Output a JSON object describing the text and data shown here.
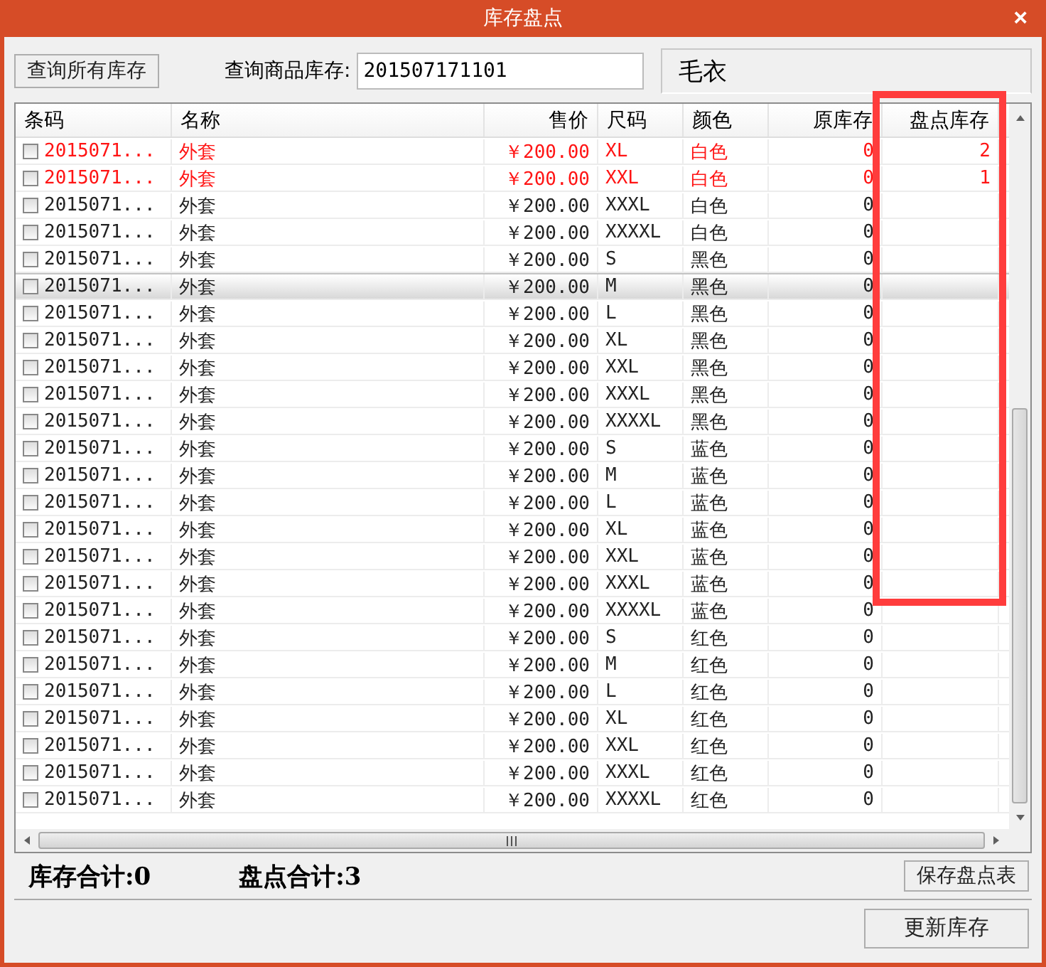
{
  "window": {
    "title": "库存盘点",
    "close": "×"
  },
  "toolbar": {
    "query_all_button": "查询所有库存",
    "search_label": "查询商品库存:",
    "search_value": "201507171101",
    "product_name": "毛衣"
  },
  "table": {
    "columns": [
      "条码",
      "名称",
      "售价",
      "尺码",
      "颜色",
      "原库存",
      "盘点库存"
    ],
    "rows": [
      {
        "checked": false,
        "modified": true,
        "selected": false,
        "barcode": "2015071...",
        "name": "外套",
        "price": "￥200.00",
        "size": "XL",
        "color_name": "白色",
        "stock": "0",
        "count": "2"
      },
      {
        "checked": false,
        "modified": true,
        "selected": false,
        "barcode": "2015071...",
        "name": "外套",
        "price": "￥200.00",
        "size": "XXL",
        "color_name": "白色",
        "stock": "0",
        "count": "1"
      },
      {
        "checked": false,
        "modified": false,
        "selected": false,
        "barcode": "2015071...",
        "name": "外套",
        "price": "￥200.00",
        "size": "XXXL",
        "color_name": "白色",
        "stock": "0"
      },
      {
        "checked": false,
        "modified": false,
        "selected": false,
        "barcode": "2015071...",
        "name": "外套",
        "price": "￥200.00",
        "size": "XXXXL",
        "color_name": "白色",
        "stock": "0"
      },
      {
        "checked": false,
        "modified": false,
        "selected": false,
        "barcode": "2015071...",
        "name": "外套",
        "price": "￥200.00",
        "size": "S",
        "color_name": "黑色",
        "stock": "0"
      },
      {
        "checked": false,
        "modified": false,
        "selected": true,
        "barcode": "2015071...",
        "name": "外套",
        "price": "￥200.00",
        "size": "M",
        "color_name": "黑色",
        "stock": "0"
      },
      {
        "checked": false,
        "modified": false,
        "selected": false,
        "barcode": "2015071...",
        "name": "外套",
        "price": "￥200.00",
        "size": "L",
        "color_name": "黑色",
        "stock": "0"
      },
      {
        "checked": false,
        "modified": false,
        "selected": false,
        "barcode": "2015071...",
        "name": "外套",
        "price": "￥200.00",
        "size": "XL",
        "color_name": "黑色",
        "stock": "0"
      },
      {
        "checked": false,
        "modified": false,
        "selected": false,
        "barcode": "2015071...",
        "name": "外套",
        "price": "￥200.00",
        "size": "XXL",
        "color_name": "黑色",
        "stock": "0"
      },
      {
        "checked": false,
        "modified": false,
        "selected": false,
        "barcode": "2015071...",
        "name": "外套",
        "price": "￥200.00",
        "size": "XXXL",
        "color_name": "黑色",
        "stock": "0"
      },
      {
        "checked": false,
        "modified": false,
        "selected": false,
        "barcode": "2015071...",
        "name": "外套",
        "price": "￥200.00",
        "size": "XXXXL",
        "color_name": "黑色",
        "stock": "0"
      },
      {
        "checked": false,
        "modified": false,
        "selected": false,
        "barcode": "2015071...",
        "name": "外套",
        "price": "￥200.00",
        "size": "S",
        "color_name": "蓝色",
        "stock": "0"
      },
      {
        "checked": false,
        "modified": false,
        "selected": false,
        "barcode": "2015071...",
        "name": "外套",
        "price": "￥200.00",
        "size": "M",
        "color_name": "蓝色",
        "stock": "0"
      },
      {
        "checked": false,
        "modified": false,
        "selected": false,
        "barcode": "2015071...",
        "name": "外套",
        "price": "￥200.00",
        "size": "L",
        "color_name": "蓝色",
        "stock": "0"
      },
      {
        "checked": false,
        "modified": false,
        "selected": false,
        "barcode": "2015071...",
        "name": "外套",
        "price": "￥200.00",
        "size": "XL",
        "color_name": "蓝色",
        "stock": "0"
      },
      {
        "checked": false,
        "modified": false,
        "selected": false,
        "barcode": "2015071...",
        "name": "外套",
        "price": "￥200.00",
        "size": "XXL",
        "color_name": "蓝色",
        "stock": "0"
      },
      {
        "checked": false,
        "modified": false,
        "selected": false,
        "barcode": "2015071...",
        "name": "外套",
        "price": "￥200.00",
        "size": "XXXL",
        "color_name": "蓝色",
        "stock": "0"
      },
      {
        "checked": false,
        "modified": false,
        "selected": false,
        "barcode": "2015071...",
        "name": "外套",
        "price": "￥200.00",
        "size": "XXXXL",
        "color_name": "蓝色",
        "stock": "0"
      },
      {
        "checked": false,
        "modified": false,
        "selected": false,
        "barcode": "2015071...",
        "name": "外套",
        "price": "￥200.00",
        "size": "S",
        "color_name": "红色",
        "stock": "0"
      },
      {
        "checked": false,
        "modified": false,
        "selected": false,
        "barcode": "2015071...",
        "name": "外套",
        "price": "￥200.00",
        "size": "M",
        "color_name": "红色",
        "stock": "0"
      },
      {
        "checked": false,
        "modified": false,
        "selected": false,
        "barcode": "2015071...",
        "name": "外套",
        "price": "￥200.00",
        "size": "L",
        "color_name": "红色",
        "stock": "0"
      },
      {
        "checked": false,
        "modified": false,
        "selected": false,
        "barcode": "2015071...",
        "name": "外套",
        "price": "￥200.00",
        "size": "XL",
        "color_name": "红色",
        "stock": "0"
      },
      {
        "checked": false,
        "modified": false,
        "selected": false,
        "barcode": "2015071...",
        "name": "外套",
        "price": "￥200.00",
        "size": "XXL",
        "color_name": "红色",
        "stock": "0"
      },
      {
        "checked": false,
        "modified": false,
        "selected": false,
        "barcode": "2015071...",
        "name": "外套",
        "price": "￥200.00",
        "size": "XXXL",
        "color_name": "红色",
        "stock": "0"
      },
      {
        "checked": false,
        "modified": false,
        "selected": false,
        "barcode": "2015071...",
        "name": "外套",
        "price": "￥200.00",
        "size": "XXXXL",
        "color_name": "红色",
        "stock": "0"
      }
    ]
  },
  "summary": {
    "stock_total": "库存合计:0",
    "count_total": "盘点合计:3",
    "save_button": "保存盘点表"
  },
  "footer": {
    "update_button": "更新库存"
  }
}
